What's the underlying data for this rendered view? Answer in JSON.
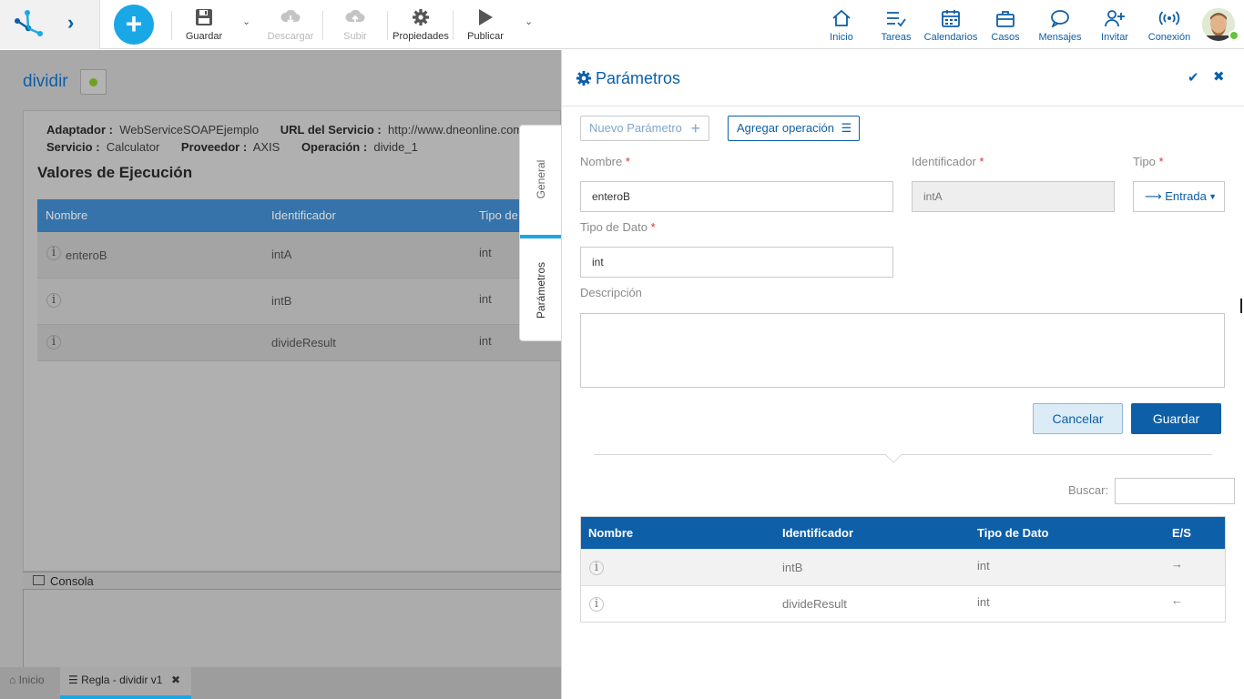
{
  "toolbar": {
    "guardar": "Guardar",
    "descargar": "Descargar",
    "subir": "Subir",
    "propiedades": "Propiedades",
    "publicar": "Publicar"
  },
  "nav": {
    "inicio": "Inicio",
    "tareas": "Tareas",
    "calendarios": "Calendarios",
    "casos": "Casos",
    "mensajes": "Mensajes",
    "invitar": "Invitar",
    "conexion": "Conexión"
  },
  "rule": {
    "title": "dividir",
    "meta": {
      "adaptador_k": "Adaptador :",
      "adaptador_v": "WebServiceSOAPEjemplo",
      "url_k": "URL del Servicio :",
      "url_v": "http://www.dneonline.com",
      "servicio_k": "Servicio :",
      "servicio_v": "Calculator",
      "proveedor_k": "Proveedor :",
      "proveedor_v": "AXIS",
      "operacion_k": "Operación :",
      "operacion_v": "divide_1"
    },
    "section_title": "Valores de Ejecución",
    "table": {
      "columns": [
        "Nombre",
        "Identificador",
        "Tipo de"
      ],
      "rows": [
        {
          "nombre": "enteroB",
          "identificador": "intA",
          "tipo": "int"
        },
        {
          "nombre": "",
          "identificador": "intB",
          "tipo": "int"
        },
        {
          "nombre": "",
          "identificador": "divideResult",
          "tipo": "int"
        }
      ]
    },
    "console_label": "Consola"
  },
  "vtabs": {
    "general": "General",
    "parametros": "Parámetros"
  },
  "bottom_tabs": {
    "home": "Inicio",
    "active": "Regla - dividir v1"
  },
  "panel": {
    "title": "Parámetros",
    "nuevo_parametro": "Nuevo Parámetro",
    "agregar_operacion": "Agregar operación",
    "form": {
      "nombre_label": "Nombre",
      "nombre_value": "enteroB",
      "identificador_label": "Identificador",
      "identificador_value": "intA",
      "tipo_label": "Tipo",
      "tipo_value": "Entrada",
      "tipo_dato_label": "Tipo de Dato",
      "tipo_dato_value": "int",
      "descripcion_label": "Descripción",
      "required_mark": "*"
    },
    "cancelar": "Cancelar",
    "guardar": "Guardar",
    "buscar_label": "Buscar:",
    "table": {
      "columns": [
        "Nombre",
        "Identificador",
        "Tipo de Dato",
        "E/S"
      ],
      "rows": [
        {
          "nombre": "",
          "identificador": "intB",
          "tipo": "int",
          "es": "→"
        },
        {
          "nombre": "",
          "identificador": "divideResult",
          "tipo": "int",
          "es": "←"
        }
      ]
    }
  },
  "colors": {
    "brand_blue": "#0d5fa8",
    "accent_cyan": "#1aa7e6",
    "status_green": "#6ba21f"
  }
}
